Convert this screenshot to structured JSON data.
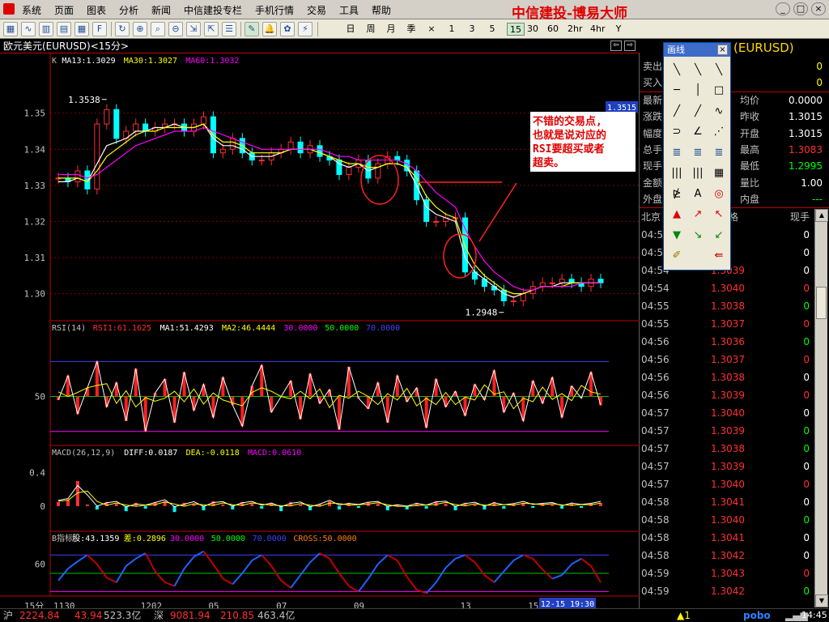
{
  "menu": [
    "系统",
    "页面",
    "图表",
    "分析",
    "新闻",
    "中信建投专栏",
    "手机行情",
    "交易",
    "工具",
    "帮助"
  ],
  "brand": "中信建投-博易大师",
  "window_buttons": [
    "_",
    "□",
    "×"
  ],
  "toolbar": {
    "periods": [
      "日",
      "周",
      "月",
      "季",
      "×",
      "1",
      "3",
      "5",
      "15",
      "30",
      "60",
      "2hr",
      "4hr",
      "Y"
    ],
    "selected_period": "15"
  },
  "chart_tab": "欧元美元(EURUSD)<15分>",
  "chart_nav": [
    "⇦",
    "⇨",
    "▭"
  ],
  "legends": {
    "price": [
      {
        "text": "K",
        "color": "#c0c0c0"
      },
      {
        "text": "MA13:1.3029",
        "color": "#ffffff"
      },
      {
        "text": "MA30:1.3027",
        "color": "#ffff00"
      },
      {
        "text": "MA60:1.3032",
        "color": "#ff00ff"
      }
    ],
    "rsi": [
      {
        "text": "RSI(14)",
        "color": "#c0c0c0"
      },
      {
        "text": "RSI1:61.1625",
        "color": "#ff3030"
      },
      {
        "text": "MA1:51.4293",
        "color": "#ffffff"
      },
      {
        "text": "MA2:46.4444",
        "color": "#ffff00"
      },
      {
        "text": "30.0000",
        "color": "#ff00ff"
      },
      {
        "text": "50.0000",
        "color": "#00ff00"
      },
      {
        "text": "70.0000",
        "color": "#4040ff"
      }
    ],
    "macd": [
      {
        "text": "MACD(26,12,9)",
        "color": "#c0c0c0"
      },
      {
        "text": "DIFF:0.0187",
        "color": "#ffffff"
      },
      {
        "text": "DEA:-0.0118",
        "color": "#ffff00"
      },
      {
        "text": "MACD:0.0610",
        "color": "#ff00ff"
      }
    ],
    "b": [
      {
        "text": "B指标",
        "color": "#c0c0c0"
      },
      {
        "text": "股:43.1359",
        "color": "#ffffff"
      },
      {
        "text": "差:0.2896",
        "color": "#ffff00"
      },
      {
        "text": "30.0000",
        "color": "#ff00ff"
      },
      {
        "text": "50.0000",
        "color": "#00ff00"
      },
      {
        "text": "70.0000",
        "color": "#4040ff"
      },
      {
        "text": "CROSS:50.0000",
        "color": "#ff8000"
      }
    ]
  },
  "annotation": {
    "text_lines": [
      "不错的交易点,",
      "也就是说对应的",
      "RSI要超买或者",
      "超卖。"
    ]
  },
  "price_markers": {
    "high": "1.3538",
    "low": "1.2948",
    "current": "1.3515"
  },
  "chart_data": [
    {
      "type": "line",
      "panel": "price",
      "y_ticks": [
        "1.35",
        "1.34",
        "1.33",
        "1.32",
        "1.31",
        "1.30"
      ],
      "ylim": [
        1.2925,
        1.3625
      ],
      "x_ticks": [
        "1130",
        "1202",
        "05",
        "07",
        "09",
        "13",
        "15"
      ],
      "series": [
        {
          "name": "K",
          "values": [
            1.332,
            1.331,
            1.334,
            1.329,
            1.347,
            1.351,
            1.343,
            1.345,
            1.347,
            1.345,
            1.346,
            1.347,
            1.347,
            1.345,
            1.347,
            1.349,
            1.339,
            1.34,
            1.343,
            1.339,
            1.337,
            1.337,
            1.339,
            1.34,
            1.342,
            1.339,
            1.341,
            1.338,
            1.337,
            1.333,
            1.335,
            1.337,
            1.332,
            1.336,
            1.338,
            1.337,
            1.334,
            1.326,
            1.32,
            1.32,
            1.321,
            1.321,
            1.306,
            1.304,
            1.302,
            1.301,
            1.298,
            1.298,
            1.3,
            1.302,
            1.303,
            1.303,
            1.304,
            1.303,
            1.302,
            1.304,
            1.303
          ]
        },
        {
          "name": "MA13",
          "values": [
            1.331,
            1.331,
            1.332,
            1.331,
            1.336,
            1.341,
            1.342,
            1.343,
            1.345,
            1.345,
            1.346,
            1.346,
            1.347,
            1.346,
            1.346,
            1.347,
            1.343,
            1.341,
            1.341,
            1.34,
            1.338,
            1.338,
            1.338,
            1.339,
            1.34,
            1.34,
            1.34,
            1.339,
            1.338,
            1.336,
            1.335,
            1.336,
            1.334,
            1.335,
            1.336,
            1.336,
            1.335,
            1.33,
            1.324,
            1.322,
            1.321,
            1.32,
            1.31,
            1.306,
            1.304,
            1.302,
            1.3,
            1.299,
            1.3,
            1.301,
            1.302,
            1.302,
            1.303,
            1.303,
            1.303,
            1.303,
            1.303
          ]
        },
        {
          "name": "MA30",
          "values": [
            1.332,
            1.332,
            1.332,
            1.331,
            1.334,
            1.338,
            1.34,
            1.342,
            1.344,
            1.345,
            1.345,
            1.346,
            1.346,
            1.346,
            1.346,
            1.347,
            1.344,
            1.342,
            1.342,
            1.341,
            1.339,
            1.339,
            1.339,
            1.339,
            1.34,
            1.34,
            1.34,
            1.339,
            1.338,
            1.337,
            1.336,
            1.336,
            1.335,
            1.335,
            1.336,
            1.336,
            1.335,
            1.332,
            1.327,
            1.324,
            1.322,
            1.321,
            1.313,
            1.308,
            1.305,
            1.303,
            1.301,
            1.3,
            1.3,
            1.301,
            1.302,
            1.302,
            1.302,
            1.303,
            1.303,
            1.303,
            1.303
          ]
        },
        {
          "name": "MA60",
          "values": [
            1.333,
            1.333,
            1.333,
            1.332,
            1.333,
            1.335,
            1.337,
            1.339,
            1.341,
            1.342,
            1.343,
            1.344,
            1.345,
            1.345,
            1.345,
            1.346,
            1.345,
            1.344,
            1.343,
            1.342,
            1.341,
            1.34,
            1.34,
            1.34,
            1.34,
            1.34,
            1.34,
            1.34,
            1.339,
            1.338,
            1.338,
            1.337,
            1.337,
            1.337,
            1.337,
            1.337,
            1.336,
            1.334,
            1.331,
            1.328,
            1.326,
            1.324,
            1.318,
            1.313,
            1.309,
            1.306,
            1.304,
            1.302,
            1.301,
            1.301,
            1.302,
            1.302,
            1.302,
            1.302,
            1.303,
            1.303,
            1.303
          ]
        }
      ]
    },
    {
      "type": "bar",
      "panel": "rsi",
      "y_ticks": [
        "50"
      ],
      "ylim": [
        22,
        85
      ],
      "values": [
        48,
        62,
        40,
        55,
        70,
        44,
        58,
        36,
        66,
        30,
        52,
        60,
        35,
        64,
        42,
        57,
        38,
        61,
        45,
        33,
        56,
        68,
        41,
        50,
        59,
        37,
        63,
        46,
        54,
        31,
        67,
        49,
        43,
        58,
        35,
        62,
        47,
        55,
        32,
        60,
        44,
        53,
        39,
        57,
        48,
        65,
        41,
        52,
        36,
        59,
        46,
        61,
        38,
        56,
        49,
        64,
        45
      ]
    },
    {
      "type": "bar",
      "panel": "macd",
      "y_ticks": [
        "0.4",
        "0"
      ],
      "ylim": [
        -0.3,
        0.55
      ],
      "values": [
        0.05,
        0.08,
        0.3,
        0.02,
        -0.04,
        0.05,
        0.03,
        -0.06,
        0.04,
        -0.03,
        0.05,
        0.06,
        -0.07,
        0.04,
        0.03,
        -0.05,
        0.06,
        0.02,
        -0.04,
        0.05,
        0.03,
        -0.03,
        0.04,
        -0.06,
        0.05,
        0.02,
        -0.05,
        0.03,
        0.06,
        -0.04,
        0.04,
        -0.02,
        0.05,
        0.03,
        -0.05,
        0.02,
        -0.04,
        0.04,
        -0.03,
        0.06,
        0.03,
        -0.05,
        0.04,
        0.02,
        -0.04,
        0.05,
        -0.03,
        0.03,
        0.04,
        -0.02,
        0.03,
        0.02,
        -0.03,
        0.04,
        -0.02,
        0.03,
        0.04
      ]
    },
    {
      "type": "line",
      "panel": "b",
      "y_ticks": [
        "60"
      ],
      "ylim": [
        25,
        80
      ],
      "values": [
        42,
        55,
        63,
        70,
        60,
        45,
        40,
        58,
        66,
        72,
        52,
        40,
        36,
        55,
        68,
        74,
        60,
        44,
        38,
        50,
        64,
        70,
        58,
        42,
        34,
        48,
        62,
        72,
        66,
        50,
        36,
        30,
        44,
        60,
        70,
        64,
        46,
        32,
        28,
        40,
        56,
        66,
        70,
        62,
        48,
        40,
        52,
        64,
        70,
        66,
        54,
        44,
        48,
        60,
        66,
        58,
        40
      ]
    }
  ],
  "quote": {
    "symbol": "(EURUSD)",
    "sell": {
      "label": "卖出",
      "value": "0"
    },
    "buy": {
      "label": "买入",
      "value": "0"
    },
    "rows": [
      {
        "l": "最新",
        "r_label": "均价",
        "r_value": "0.0000",
        "r_color": "#ffffff"
      },
      {
        "l": "涨跌",
        "r_label": "昨收",
        "r_value": "1.3015",
        "r_color": "#ffffff"
      },
      {
        "l": "幅度",
        "r_label": "开盘",
        "r_value": "1.3015",
        "r_color": "#ffffff"
      },
      {
        "l": "总手",
        "r_label": "最高",
        "r_value": "1.3083",
        "r_color": "#ff3030"
      },
      {
        "l": "现手",
        "r_label": "最低",
        "r_value": "1.2995",
        "r_color": "#00ff00"
      },
      {
        "l": "金额",
        "r_label": "量比",
        "r_value": "1.00",
        "r_color": "#ffffff"
      },
      {
        "l": "外盘",
        "r_label": "内盘",
        "r_value": "---",
        "r_color": "#00ff00"
      }
    ],
    "tick_header": {
      "time": "北京",
      "price": "格",
      "qty": "现手"
    },
    "ticks": [
      {
        "t": "04:5",
        "p": ".36",
        "q": "0",
        "qc": "#ffffff"
      },
      {
        "t": "04:5",
        "p": "",
        "q": "0",
        "qc": "#ffffff"
      },
      {
        "t": "04:54",
        "p": "1.3039",
        "q": "0",
        "qc": "#ffffff"
      },
      {
        "t": "04:54",
        "p": "1.3040",
        "q": "0",
        "qc": "#ff3030"
      },
      {
        "t": "04:55",
        "p": "1.3038",
        "q": "0",
        "qc": "#00ff00"
      },
      {
        "t": "04:55",
        "p": "1.3037",
        "q": "0",
        "qc": "#ff3030"
      },
      {
        "t": "04:56",
        "p": "1.3036",
        "q": "0",
        "qc": "#00ff00"
      },
      {
        "t": "04:56",
        "p": "1.3037",
        "q": "0",
        "qc": "#ff3030"
      },
      {
        "t": "04:56",
        "p": "1.3038",
        "q": "0",
        "qc": "#ffffff"
      },
      {
        "t": "04:56",
        "p": "1.3039",
        "q": "0",
        "qc": "#ff3030"
      },
      {
        "t": "04:57",
        "p": "1.3040",
        "q": "0",
        "qc": "#ffffff"
      },
      {
        "t": "04:57",
        "p": "1.3039",
        "q": "0",
        "qc": "#00ff00"
      },
      {
        "t": "04:57",
        "p": "1.3038",
        "q": "0",
        "qc": "#00ff00"
      },
      {
        "t": "04:57",
        "p": "1.3039",
        "q": "0",
        "qc": "#ffffff"
      },
      {
        "t": "04:57",
        "p": "1.3040",
        "q": "0",
        "qc": "#ff3030"
      },
      {
        "t": "04:58",
        "p": "1.3041",
        "q": "0",
        "qc": "#ffffff"
      },
      {
        "t": "04:58",
        "p": "1.3040",
        "q": "0",
        "qc": "#00ff00"
      },
      {
        "t": "04:58",
        "p": "1.3041",
        "q": "0",
        "qc": "#ffffff"
      },
      {
        "t": "04:58",
        "p": "1.3042",
        "q": "0",
        "qc": "#ffffff"
      },
      {
        "t": "04:59",
        "p": "1.3043",
        "q": "0",
        "qc": "#ff3030"
      },
      {
        "t": "04:59",
        "p": "1.3042",
        "q": "0",
        "qc": "#00ff00"
      }
    ]
  },
  "drawing_tools": {
    "title": "画线",
    "close": "×",
    "text_tool": "A"
  },
  "status": {
    "period_label": "15分",
    "cursor_time": "12-15 19:30",
    "sh_label": "沪",
    "sh_index": "2224.84",
    "sh_change": "43.94",
    "sh_amount": "523.3亿",
    "sz_label": "深",
    "sz_index": "9081.94",
    "sz_change": "210.85",
    "sz_amount": "463.4亿",
    "alert": "▲1",
    "brand": "pobo",
    "clock": "14:45"
  }
}
